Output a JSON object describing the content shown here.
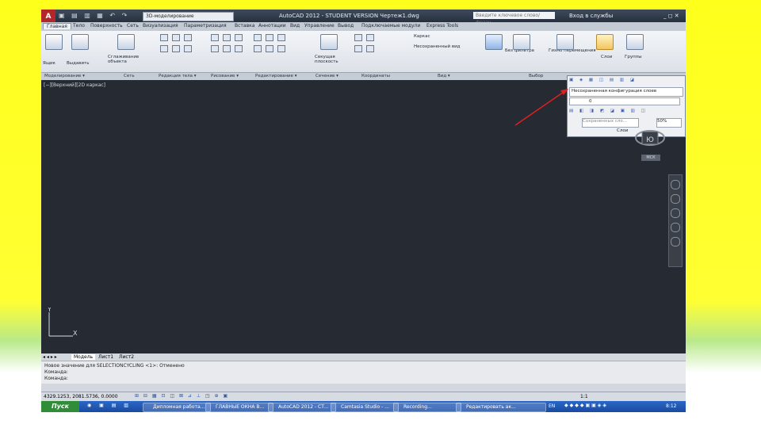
{
  "window": {
    "app_badge": "A",
    "workspace": "3D-моделирование",
    "title": "AutoCAD 2012 - STUDENT VERSION   Чертеж1.dwg",
    "search_placeholder": "Введите ключевое слово/фразу",
    "signin": "Вход в службы",
    "win_controls": "_ ◻ ✕"
  },
  "ribbon_tabs": [
    "Главная",
    "Тело",
    "Поверхность",
    "Сеть",
    "Визуализация",
    "Параметризация",
    "Вставка",
    "Аннотации",
    "Вид",
    "Управление",
    "Вывод",
    "Подключаемые модули",
    "Express Tools"
  ],
  "ribbon": {
    "box": "Ящик",
    "extrude": "Выдавить",
    "smooth_obj": "Сглаживание объекта",
    "section_plane": "Секущая плоскость",
    "layer_state": "Несохраненное состоя...",
    "layer_current": "Несохраненный вид",
    "visual_style": "Каркас",
    "layers_btn": "Слои",
    "groups_btn": "Группы",
    "gizmo": "Без фильтра",
    "move_gizmo": "Гизмо перемещения"
  },
  "panel_bar": [
    "Моделирование ▾",
    "Сеть",
    "Редакция тела ▾",
    "Рисование ▾",
    "Редактирование ▾",
    "Сечение ▾",
    "Координаты",
    "Вид ▾",
    "Выбор"
  ],
  "viewport": {
    "label": "[−][Верхний][2D каркас]",
    "cube_label": "Ю",
    "wcs": "МСК"
  },
  "model_tabs": [
    "Модель",
    "Лист1",
    "Лист2"
  ],
  "command": {
    "line1": "Новое значение для SELECTIONCYCLING <1>: Отменено",
    "line2": "Команда:",
    "line3": "Команда:"
  },
  "status": {
    "coords": "4329.1253, 2081.5736, 0.0000",
    "scale": "1:1"
  },
  "popup": {
    "layer_combo": "Несохраненная конфигурация слоев",
    "layer_name": "0",
    "bottom_text": "Сохраненных сло...",
    "pct": "50%",
    "title": "Слои"
  },
  "taskbar": {
    "start": "Пуск",
    "tasks": [
      "Дипломная работа...",
      "ГЛАВНЫЕ ОКНА В...",
      "AutoCAD 2012 - СТ...",
      "Camtasia Studio - ...",
      "Recording...",
      "Редактировать ак..."
    ],
    "lang": "EN",
    "clock": "8:12"
  }
}
